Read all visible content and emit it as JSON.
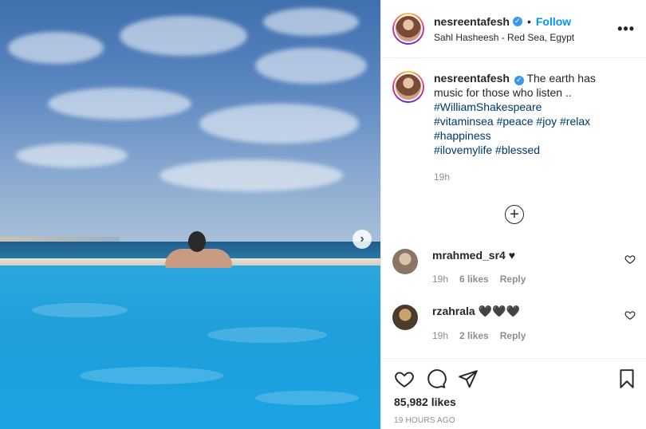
{
  "post": {
    "username": "nesreentafesh",
    "verified_glyph": "✓",
    "dot": "•",
    "follow_label": "Follow",
    "location": "Sahl Hasheesh - Red Sea, Egypt",
    "more_label": "•••",
    "next_icon": "chevron-right-icon"
  },
  "caption": {
    "username": "nesreentafesh",
    "text": "The earth has music for those who listen ..",
    "hashtag_line1": [
      "#WilliamShakespeare"
    ],
    "hashtag_line2": [
      "#vitaminsea",
      "#peace",
      "#joy",
      "#relax"
    ],
    "hashtag_line3": [
      "#happiness"
    ],
    "hashtag_line4": [
      "#ilovemylife",
      "#blessed"
    ],
    "time": "19h"
  },
  "load_more_label": "+",
  "comments": [
    {
      "username": "mrahmed_sr4",
      "text": "♥",
      "time": "19h",
      "likes": "6 likes",
      "reply": "Reply"
    },
    {
      "username": "rzahrala",
      "text": "🖤🖤🖤",
      "time": "19h",
      "likes": "2 likes",
      "reply": "Reply"
    }
  ],
  "likes_count": "85,982 likes",
  "posted_ago": "19 HOURS AGO",
  "colors": {
    "link": "#0095f6",
    "hashtag": "#00376b",
    "muted": "#8e8e8e",
    "pool": "#1fa1dd"
  }
}
